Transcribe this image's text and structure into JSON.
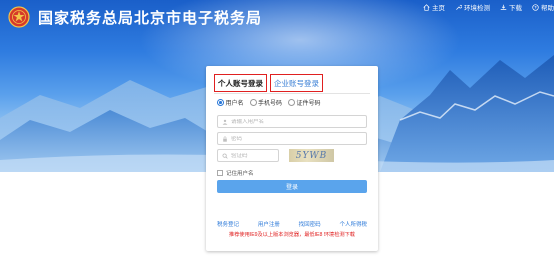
{
  "header": {
    "title": "国家税务总局北京市电子税务局",
    "nav": [
      {
        "label": "主页",
        "icon": "home-icon"
      },
      {
        "label": "环境检测",
        "icon": "wrench-icon"
      },
      {
        "label": "下载",
        "icon": "download-icon"
      },
      {
        "label": "帮助",
        "icon": "help-icon"
      }
    ]
  },
  "login": {
    "tabs": [
      "个人账号登录",
      "企业账号登录"
    ],
    "radios": [
      "用户名",
      "手机号码",
      "证件号码"
    ],
    "username_placeholder": "请输入用户名",
    "password_placeholder": "密码",
    "captcha_placeholder": "验证码",
    "captcha_text": "5YWB",
    "remember_label": "记住用户名",
    "submit_label": "登录",
    "links": [
      "税务登记",
      "用户注册",
      "找回密码",
      "个人所得税"
    ],
    "note": "推荐使用IE9及以上版本浏览器，最低IE8 环境检测下载"
  },
  "colors": {
    "accent_blue": "#5aa4ec",
    "link_blue": "#2a78d8",
    "highlight_red": "#e02020",
    "banner_blue": "#1a5fc9"
  }
}
